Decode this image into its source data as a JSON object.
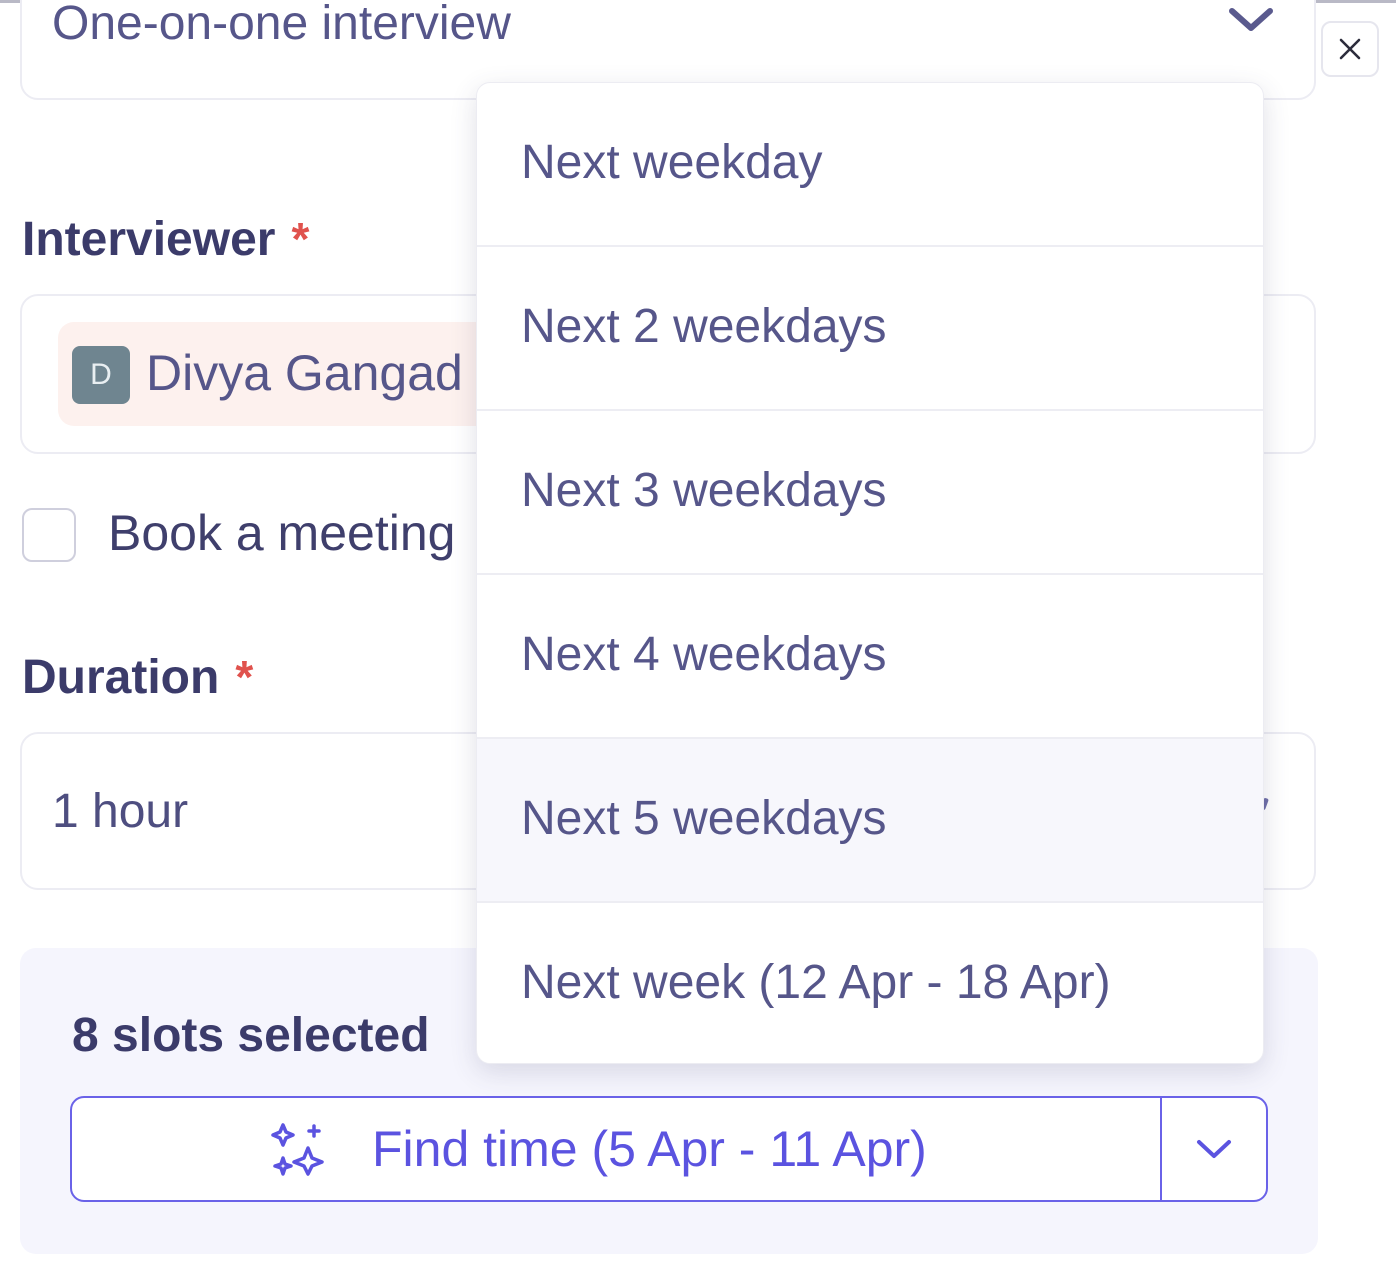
{
  "interview_type": {
    "value": "One-on-one interview"
  },
  "interviewer": {
    "label": "Interviewer",
    "required_mark": "*",
    "selected": {
      "initial": "D",
      "name": "Divya Gangad"
    }
  },
  "book_meeting": {
    "label": "Book a meeting",
    "checked": false
  },
  "duration": {
    "label": "Duration",
    "required_mark": "*",
    "value": "1 hour"
  },
  "slots": {
    "title": "8 slots selected",
    "find_time_label": "Find time (5 Apr - 11 Apr)"
  },
  "dropdown": {
    "items": [
      {
        "label": "Next weekday"
      },
      {
        "label": "Next 2 weekdays"
      },
      {
        "label": "Next 3 weekdays"
      },
      {
        "label": "Next 4 weekdays"
      },
      {
        "label": "Next 5 weekdays",
        "hovered": true
      },
      {
        "label": "Next week (12 Apr - 18 Apr)"
      }
    ]
  },
  "colors": {
    "accent": "#5b53e0",
    "required": "#e0524d",
    "text": "#4a4a7a"
  },
  "icons": {
    "close": "close-icon",
    "chevron": "chevron-down-icon",
    "find_time": "sparkles-icon",
    "avatar": "avatar"
  }
}
